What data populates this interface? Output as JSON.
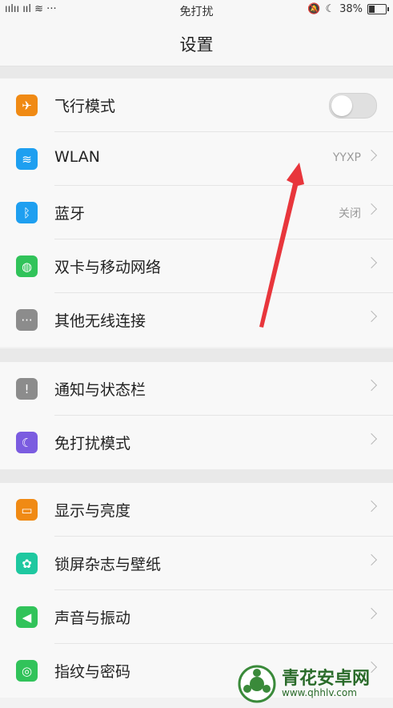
{
  "statusbar": {
    "left": "ıılıı ııl ≋ ···",
    "center": "免打扰",
    "battery_percent": "38%",
    "battery_level": 0.38
  },
  "header": {
    "title": "设置"
  },
  "groups": [
    {
      "rows": [
        {
          "label": "飞行模式",
          "icon": "airplane-icon",
          "color": "#f08a14",
          "toggle": true,
          "toggle_on": false
        },
        {
          "label": "WLAN",
          "icon": "wifi-icon",
          "color": "#1e9ff0",
          "value": "YYXP"
        },
        {
          "label": "蓝牙",
          "icon": "bluetooth-icon",
          "color": "#1e9ff0",
          "value": "关闭"
        },
        {
          "label": "双卡与移动网络",
          "icon": "globe-icon",
          "color": "#31c35a"
        },
        {
          "label": "其他无线连接",
          "icon": "more-icon",
          "color": "#8c8c8c"
        }
      ]
    },
    {
      "rows": [
        {
          "label": "通知与状态栏",
          "icon": "exclamation-icon",
          "color": "#8c8c8c"
        },
        {
          "label": "免打扰模式",
          "icon": "moon-icon",
          "color": "#7b5ce0"
        }
      ]
    },
    {
      "rows": [
        {
          "label": "显示与亮度",
          "icon": "monitor-icon",
          "color": "#f08a14"
        },
        {
          "label": "锁屏杂志与壁纸",
          "icon": "flower-icon",
          "color": "#1ec8a0"
        },
        {
          "label": "声音与振动",
          "icon": "speaker-icon",
          "color": "#31c35a"
        },
        {
          "label": "指纹与密码",
          "icon": "fingerprint-icon",
          "color": "#31c35a"
        }
      ]
    }
  ],
  "watermark": {
    "name": "青花安卓网",
    "url": "www.qhhlv.com"
  }
}
